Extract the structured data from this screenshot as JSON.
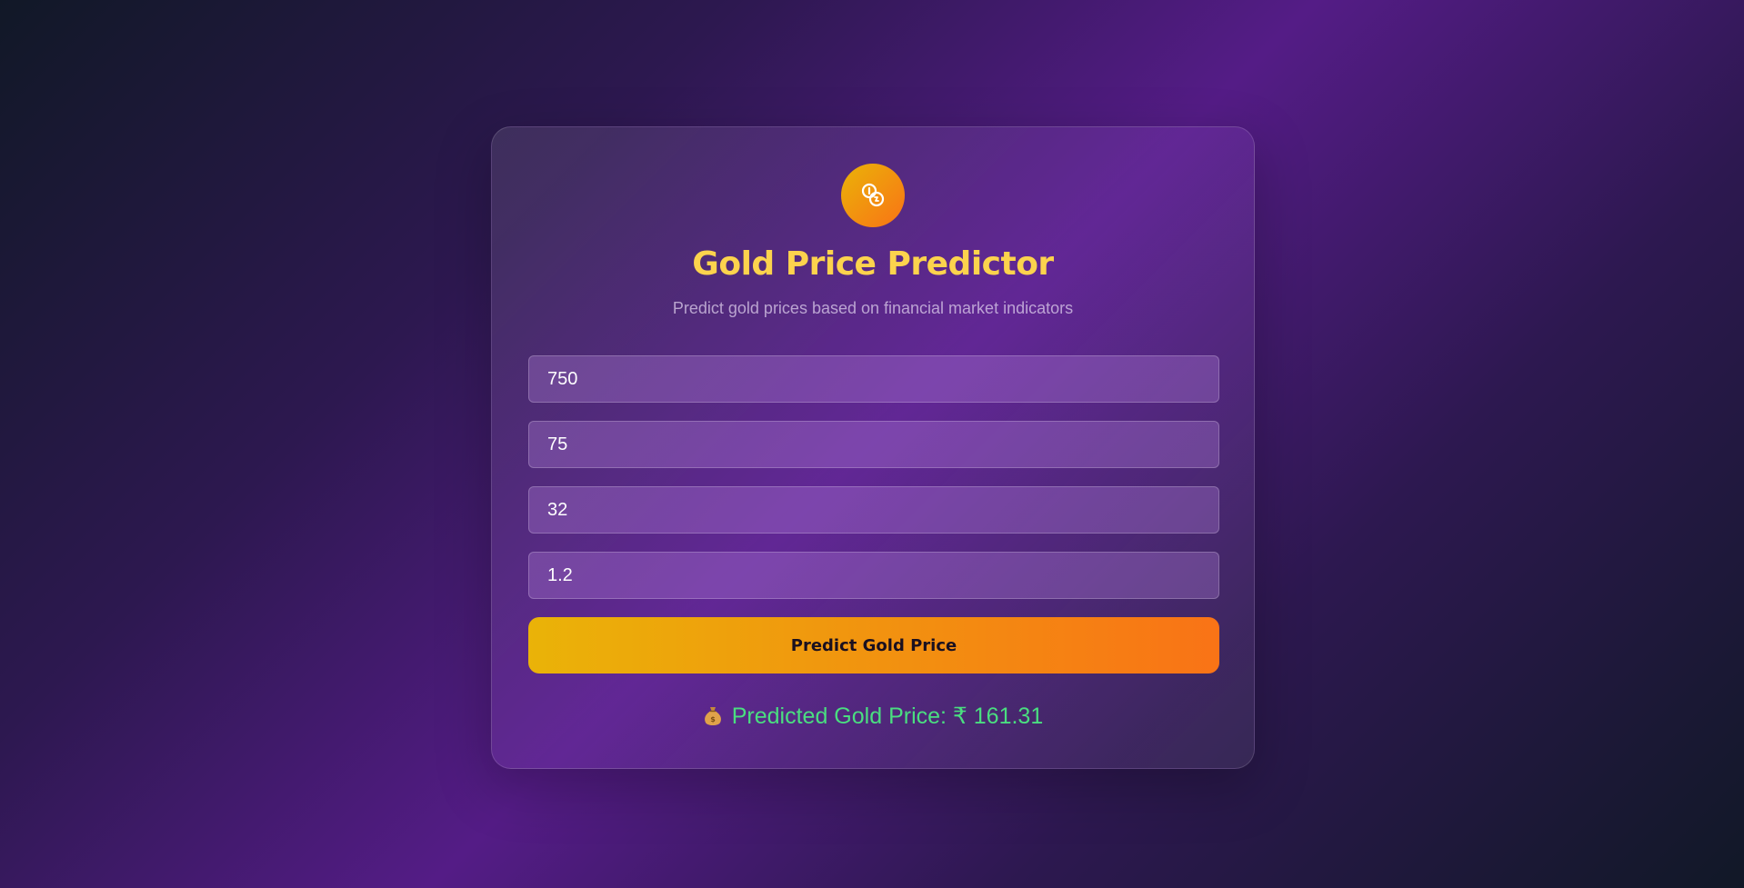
{
  "app": {
    "title": "Gold Price Predictor",
    "subtitle": "Predict gold prices based on financial market indicators",
    "logo_icon": "coins-icon",
    "accent_color": "#fcd34d"
  },
  "form": {
    "fields": [
      {
        "value": "750"
      },
      {
        "value": "75"
      },
      {
        "value": "32"
      },
      {
        "value": "1.2"
      }
    ],
    "submit_label": "Predict Gold Price"
  },
  "result": {
    "icon": "money-bag-icon",
    "text": "Predicted Gold Price: ₹ 161.31",
    "color": "#4ade80"
  }
}
